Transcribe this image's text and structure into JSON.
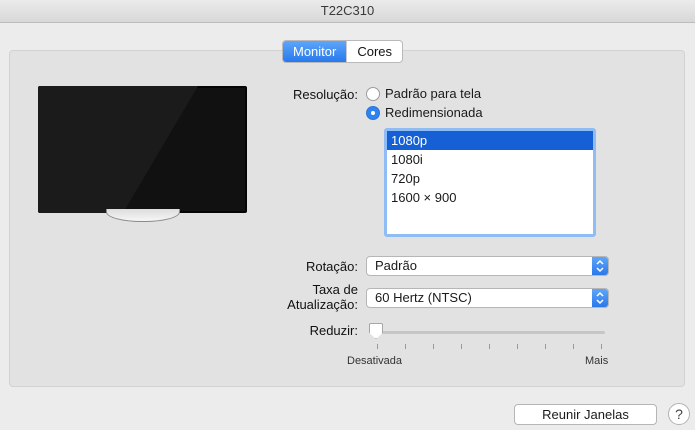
{
  "window": {
    "title": "T22C310"
  },
  "tabs": [
    {
      "label": "Monitor",
      "active": true
    },
    {
      "label": "Cores",
      "active": false
    }
  ],
  "resolution": {
    "label": "Resolução:",
    "options": [
      {
        "label": "Padrão para tela",
        "selected": false
      },
      {
        "label": "Redimensionada",
        "selected": true
      }
    ],
    "list": [
      "1080p",
      "1080i",
      "720p",
      "1600 × 900"
    ],
    "selected_index": 0
  },
  "rotation": {
    "label": "Rotação:",
    "value": "Padrão"
  },
  "refresh": {
    "label_line1": "Taxa de",
    "label_line2": "Atualização:",
    "value": "60 Hertz (NTSC)"
  },
  "reduce": {
    "label": "Reduzir:",
    "min_label": "Desativada",
    "max_label": "Mais",
    "value_fraction": 0
  },
  "footer": {
    "gather_button": "Reunir Janelas",
    "help": "?"
  },
  "colors": {
    "accent": "#2779ee",
    "list_selection": "#1660d6"
  },
  "icons": {
    "help": "question-icon",
    "popup": "chevron-updown-icon"
  }
}
